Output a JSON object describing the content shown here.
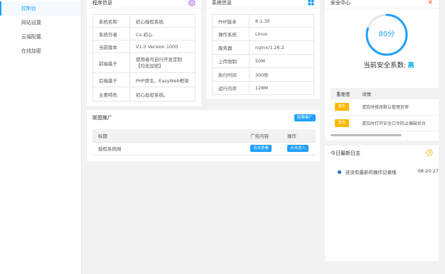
{
  "sidebar": {
    "items": [
      {
        "label": "控制台",
        "active": true
      },
      {
        "label": "网站设置",
        "active": false
      },
      {
        "label": "云端配置",
        "active": false
      },
      {
        "label": "在线加密",
        "active": false
      }
    ]
  },
  "program_info": {
    "title": "程序信息",
    "rows": [
      {
        "key": "系统名称",
        "value": "初心授权系统"
      },
      {
        "key": "系统作者",
        "value": "Cx.初心"
      },
      {
        "key": "当前版本",
        "value": "V1.0 Version 1000"
      },
      {
        "key": "前端基于",
        "value": "使用者可自行开发定制【均无加密】"
      },
      {
        "key": "后端基于",
        "value": "PHP原生、EasyWeb框架"
      },
      {
        "key": "主要特色",
        "value": "初心加密系统。"
      }
    ]
  },
  "system_info": {
    "title": "系统信息",
    "rows": [
      {
        "key": "PHP版本",
        "value": "8.1.30"
      },
      {
        "key": "操作系统",
        "value": "Linux"
      },
      {
        "key": "服务器",
        "value": "nginx/1.26.2"
      },
      {
        "key": "上传限制",
        "value": "50M"
      },
      {
        "key": "执行时间",
        "value": "300秒"
      },
      {
        "key": "运行内存",
        "value": "128M"
      }
    ]
  },
  "promo": {
    "title": "联盟推广",
    "button": "股票推广",
    "headers": [
      "标题",
      "广告内容",
      "操作"
    ],
    "rows": [
      {
        "title": "授权系统网",
        "content_btn": "点击查看",
        "action_btn": "点击进入"
      }
    ]
  },
  "security": {
    "title": "安全中心",
    "score": "80分",
    "score_value": 80,
    "level_label": "当前安全系数:",
    "level_value": "高",
    "headers": [
      "重要度",
      "详情"
    ],
    "rows": [
      {
        "level": "警告",
        "detail": "请及时修改默认管理员密"
      },
      {
        "level": "警告",
        "detail": "请及时打开安全口令防止爆破后台"
      }
    ],
    "colors": {
      "ring": "#1e9fff",
      "ring_bg": "#e6e6e6",
      "level_badge": "#ffb800",
      "level_text": "#19b2e8",
      "close": "#ff5722"
    }
  },
  "log": {
    "title": "今日最新日志",
    "items": [
      {
        "text": "还没有最新的操作记录哦",
        "time": "08:20:27"
      }
    ]
  }
}
